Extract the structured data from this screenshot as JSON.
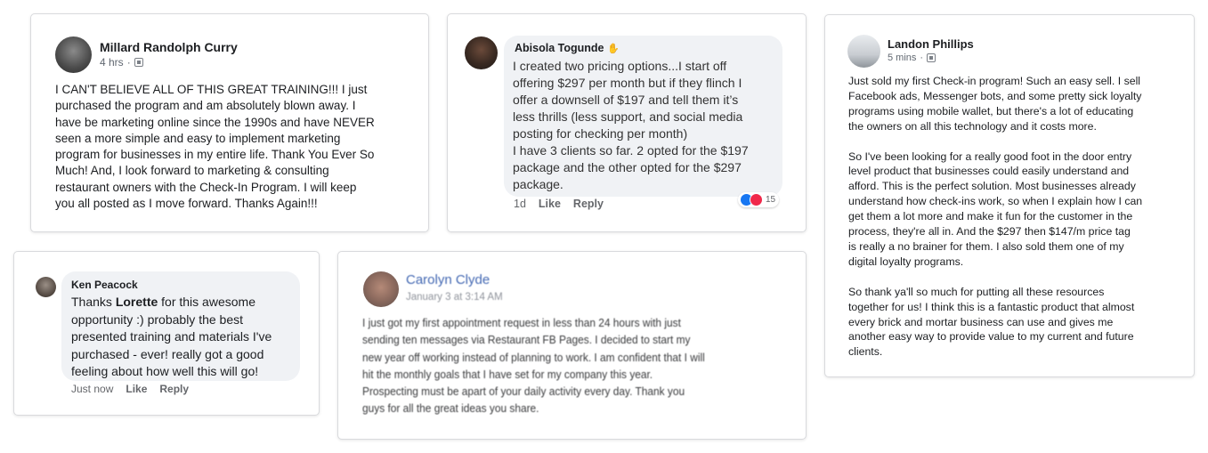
{
  "millard": {
    "name": "Millard Randolph Curry",
    "time": "4 hrs",
    "text": "I CAN'T BELIEVE ALL OF THIS GREAT TRAINING!!!  I just\npurchased the program and am absolutely blown away.  I\nhave be marketing online since the 1990s and have NEVER\nseen a more simple and easy to implement marketing\nprogram for businesses in my entire life.  Thank You Ever So\nMuch!  And, I look forward to marketing & consulting\nrestaurant owners with the Check-In Program.  I will keep\nyou all posted as I move forward.  Thanks Again!!!"
  },
  "abisola": {
    "name": "Abisola Togunde",
    "text": "I created two pricing options...I start off\noffering $297 per month but if they flinch I\noffer a downsell of $197 and tell them it’s\nless thrills (less support, and social media\nposting for checking per month)\nI have 3 clients so far. 2 opted for the $197\npackage and the other opted for the $297\npackage.",
    "time": "1d",
    "like": "Like",
    "reply": "Reply",
    "reactions": "15"
  },
  "landon": {
    "name": "Landon Phillips",
    "time": "5 mins",
    "text": "Just sold my first Check-in program! Such an easy sell. I sell\nFacebook ads, Messenger bots, and some pretty sick loyalty\nprograms using mobile wallet, but there's a lot of educating\nthe owners on all this technology and it costs more.\n\nSo I've been looking for a really good foot in the door entry\nlevel product that businesses could easily understand and\nafford. This is the perfect solution. Most businesses already\nunderstand how check-ins work, so when I explain how I can\nget them a lot more and make it fun for the customer in the\nprocess, they're all in. And the $297 then $147/m price tag\nis really a no brainer for them. I also sold them one of my\ndigital loyalty programs.\n\nSo thank ya'll so much for putting all these resources\ntogether for us! I think this is a fantastic product that almost\nevery brick and mortar business can use and gives me\nanother easy way to provide value to my current and future\nclients."
  },
  "ken": {
    "name": "Ken Peacock",
    "text_before": "Thanks ",
    "mention": "Lorette",
    "text_after": " for this awesome\nopportunity  :)  probably  the best\npresented training and materials I've\npurchased - ever!  really got a good\nfeeling about how well this will go!",
    "time": "Just now",
    "like": "Like",
    "reply": "Reply"
  },
  "carolyn": {
    "name": "Carolyn Clyde",
    "time": "January 3 at 3:14 AM",
    "text": "I just got my first appointment request in less than 24 hours with just\nsending ten messages via Restaurant FB Pages. I decided to start my\nnew year off working instead of planning to work. I am confident that I will\nhit the monthly goals that I have set for my company this year.\nProspecting must be apart of your daily activity every day. Thank you\nguys for all the great ideas you share."
  },
  "colors": {
    "link_blue": "#4267b2",
    "like_blue": "#1877f2",
    "love_red": "#f0284a",
    "bubble_gray": "#f0f2f5"
  }
}
